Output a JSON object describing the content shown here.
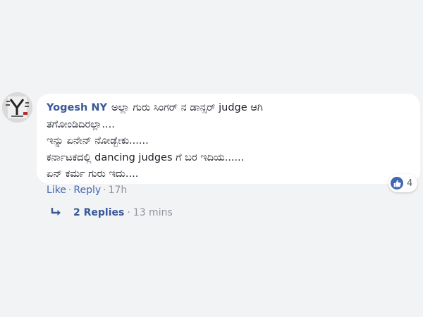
{
  "comment": {
    "author": "Yogesh NY",
    "lines": [
      "ಅಲ್ಲಾ ಗುರು ಸಿಂಗರ್ ನ ಡಾನ್ಸರ್ judge ಆಗಿ",
      "ತಗೋಂಡಿದಿರಲ್ಲಾ....",
      "ಇನ್ನು ಏನೇನ್ ನೋಡ್ಬೇಕು......",
      "ಕರ್ನಾಟಕದಲ್ಲಿ dancing judges ಗೆ ಬರ ಇದಿಯ......",
      "ಏನ್ ಕರ್ಮ ಗುರು ಇದು...."
    ],
    "avatar_icon": "profile-photo",
    "reactions": {
      "icon": "thumbs-up-icon",
      "count": "4",
      "color": "#4267b2"
    }
  },
  "actions": {
    "like_label": "Like",
    "separator": "·",
    "reply_label": "Reply",
    "time": "17h"
  },
  "replies": {
    "icon": "reply-arrow-icon",
    "label": "2 Replies",
    "separator": "·",
    "time": "13 mins"
  },
  "colors": {
    "background": "#f2f3f5",
    "bubble": "#ffffff",
    "link": "#385898",
    "muted": "#90949c",
    "text": "#1d2129"
  }
}
